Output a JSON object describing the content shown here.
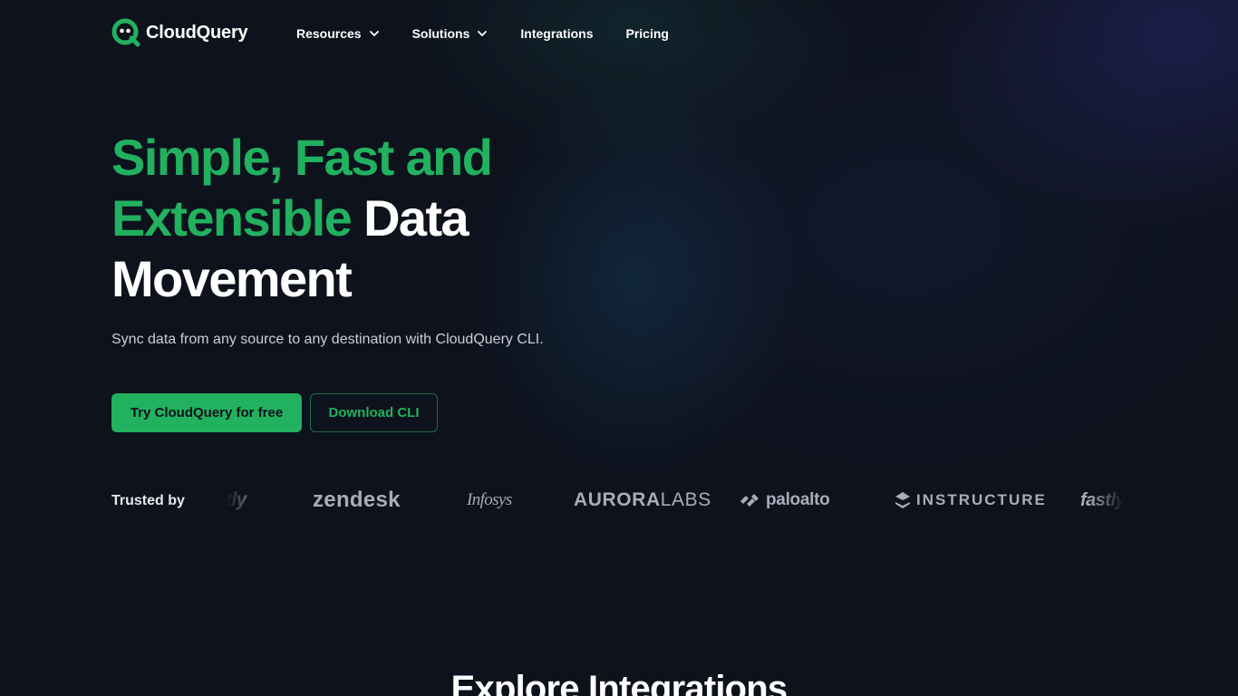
{
  "brand": {
    "name": "CloudQuery",
    "accent": "#21b15f",
    "background": "#0e121d"
  },
  "nav": {
    "items": [
      {
        "label": "Resources",
        "has_dropdown": true
      },
      {
        "label": "Solutions",
        "has_dropdown": true
      },
      {
        "label": "Integrations",
        "has_dropdown": false
      },
      {
        "label": "Pricing",
        "has_dropdown": false
      }
    ]
  },
  "hero": {
    "title_green": "Simple, Fast and Extensible",
    "title_white_1": "Data",
    "title_white_2": "Movement",
    "subtitle": "Sync data from any source to any destination with CloudQuery CLI.",
    "primary_cta": "Try CloudQuery for free",
    "secondary_cta": "Download CLI"
  },
  "trusted": {
    "label": "Trusted by",
    "logos": [
      {
        "name": "fastly",
        "text": "fastly",
        "icon": "fastly-logo"
      },
      {
        "name": "zendesk",
        "text": "zendesk",
        "icon": "zendesk-logo"
      },
      {
        "name": "infosys",
        "text": "Infosys",
        "icon": "infosys-logo"
      },
      {
        "name": "auroralabs",
        "text_a": "AURORA",
        "text_b": "LABS",
        "icon": "auroralabs-logo"
      },
      {
        "name": "paloalto",
        "text": "paloalto",
        "icon": "paloalto-logo"
      },
      {
        "name": "instructure",
        "text": "INSTRUCTURE",
        "icon": "instructure-logo"
      },
      {
        "name": "fastly",
        "text": "fastly",
        "icon": "fastly-logo"
      }
    ]
  },
  "explore": {
    "title": "Explore Integrations"
  }
}
